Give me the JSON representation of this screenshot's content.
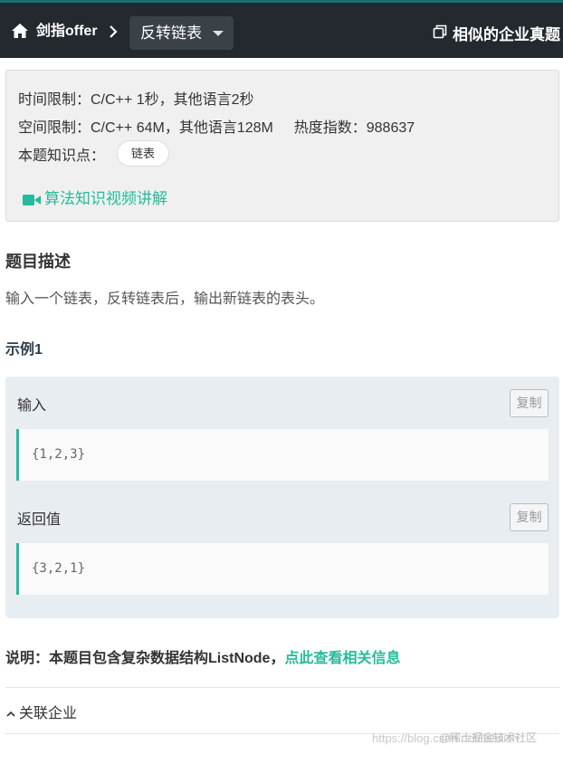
{
  "header": {
    "breadcrumb_root": "剑指offer",
    "title": "反转链表",
    "similar_label": "相似的企业真题",
    "icons": [
      "home-icon",
      "chevron-right-icon",
      "caret-down-icon",
      "copy-icon"
    ]
  },
  "info": {
    "time_limit": "时间限制：C/C++ 1秒，其他语言2秒",
    "space_limit": "空间限制：C/C++ 64M，其他语言128M",
    "heat_index": "热度指数：988637",
    "knowledge_label": "本题知识点：",
    "knowledge_tag": "链表",
    "video_link": "算法知识视频讲解"
  },
  "description": {
    "heading": "题目描述",
    "text": "输入一个链表，反转链表后，输出新链表的表头。"
  },
  "example": {
    "heading": "示例1",
    "input_label": "输入",
    "input_value": "{1,2,3}",
    "output_label": "返回值",
    "output_value": "{3,2,1}",
    "copy_label": "复制"
  },
  "note": {
    "text": "说明：本题目包含复杂数据结构ListNode，",
    "link": "点此查看相关信息"
  },
  "related": {
    "label": "关联企业"
  },
  "watermark": {
    "url": "https://blog.csdn.net/lishilish",
    "brand": "@稀土掘金技术社区"
  },
  "colors": {
    "topbar": "#23292f",
    "accent": "#25bb9b",
    "dropdown_bg": "#3a4147"
  }
}
